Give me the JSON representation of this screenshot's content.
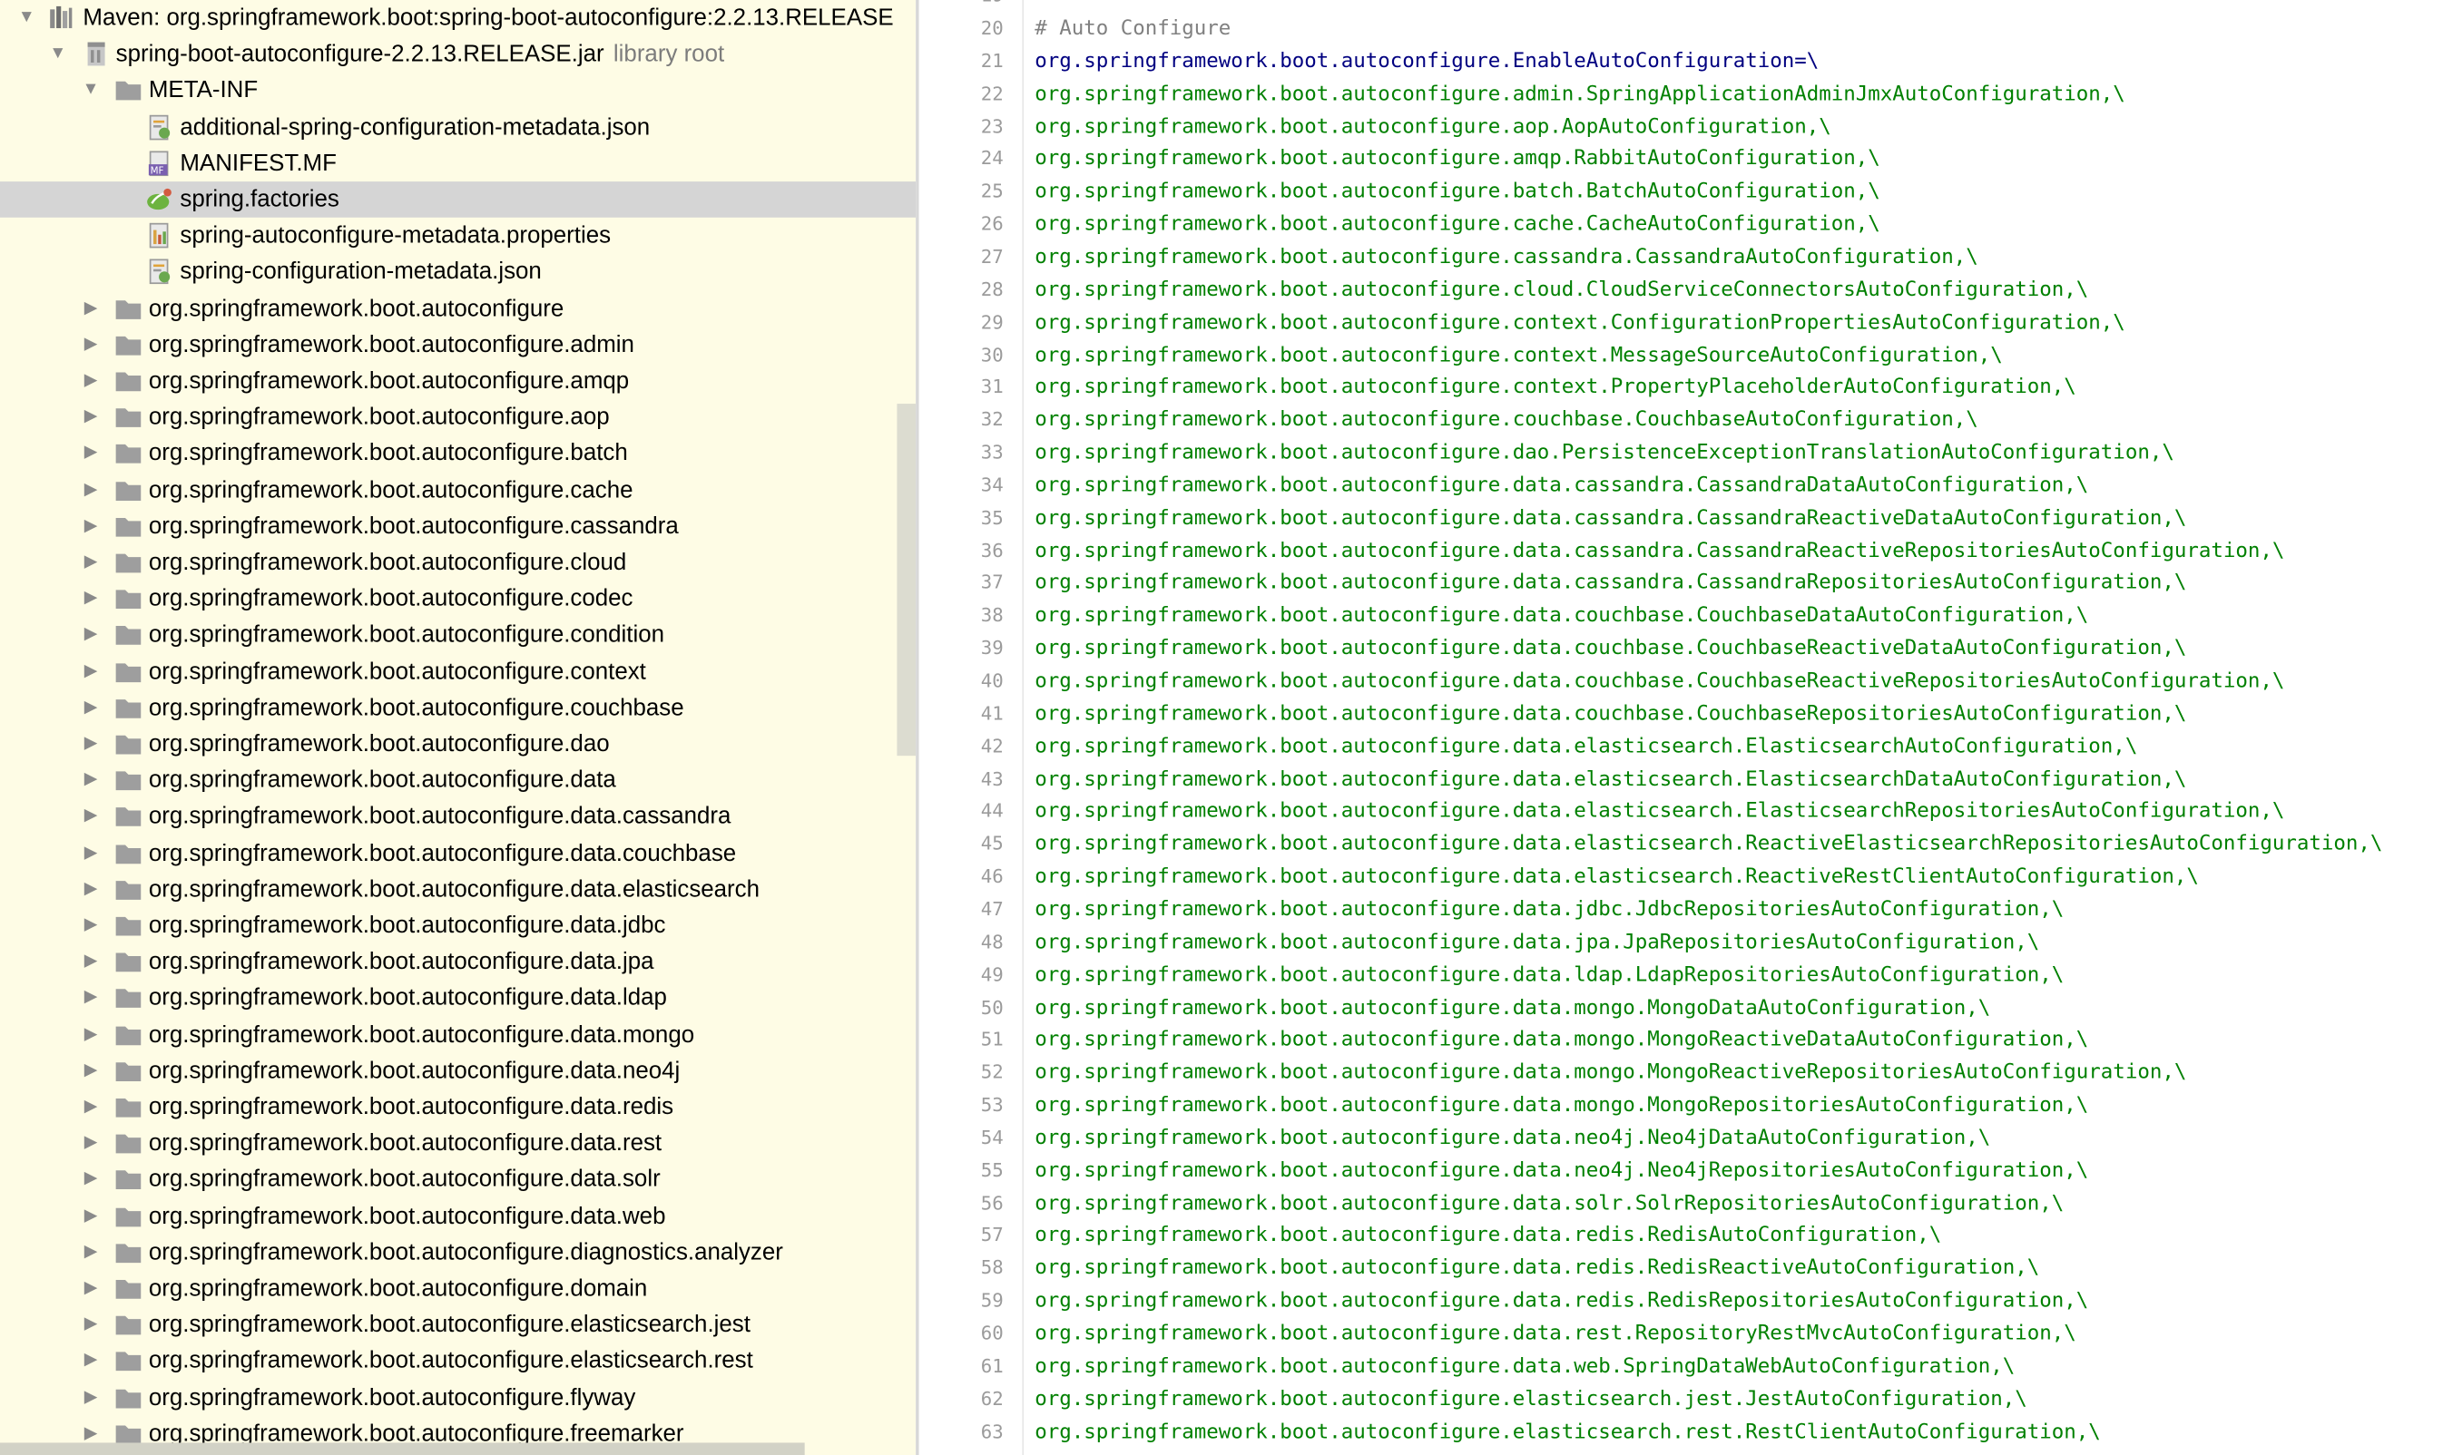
{
  "colors": {
    "tree_background": "#fefce5",
    "selected_row": "#d5d5d5",
    "property_key": "#000080",
    "property_value": "#008000",
    "comment": "#808080",
    "line_number": "#9b9b9b"
  },
  "tree": [
    {
      "label": "Maven: org.springframework.boot:spring-boot-autoconfigure:2.2.13.RELEASE",
      "icon": "library-icon",
      "state": "expanded"
    },
    {
      "label": "spring-boot-autoconfigure-2.2.13.RELEASE.jar",
      "sub": "library root",
      "icon": "jar-icon",
      "state": "expanded"
    },
    {
      "label": "META-INF",
      "icon": "folder-icon",
      "state": "expanded"
    },
    {
      "label": "additional-spring-configuration-metadata.json",
      "icon": "json-file-icon"
    },
    {
      "label": "MANIFEST.MF",
      "icon": "manifest-file-icon"
    },
    {
      "label": "spring.factories",
      "icon": "spring-factories-icon",
      "selected": true
    },
    {
      "label": "spring-autoconfigure-metadata.properties",
      "icon": "properties-file-icon"
    },
    {
      "label": "spring-configuration-metadata.json",
      "icon": "json-file-icon"
    },
    {
      "label": "org.springframework.boot.autoconfigure",
      "icon": "package-icon",
      "state": "collapsed"
    },
    {
      "label": "org.springframework.boot.autoconfigure.admin",
      "icon": "package-icon",
      "state": "collapsed"
    },
    {
      "label": "org.springframework.boot.autoconfigure.amqp",
      "icon": "package-icon",
      "state": "collapsed"
    },
    {
      "label": "org.springframework.boot.autoconfigure.aop",
      "icon": "package-icon",
      "state": "collapsed"
    },
    {
      "label": "org.springframework.boot.autoconfigure.batch",
      "icon": "package-icon",
      "state": "collapsed"
    },
    {
      "label": "org.springframework.boot.autoconfigure.cache",
      "icon": "package-icon",
      "state": "collapsed"
    },
    {
      "label": "org.springframework.boot.autoconfigure.cassandra",
      "icon": "package-icon",
      "state": "collapsed"
    },
    {
      "label": "org.springframework.boot.autoconfigure.cloud",
      "icon": "package-icon",
      "state": "collapsed"
    },
    {
      "label": "org.springframework.boot.autoconfigure.codec",
      "icon": "package-icon",
      "state": "collapsed"
    },
    {
      "label": "org.springframework.boot.autoconfigure.condition",
      "icon": "package-icon",
      "state": "collapsed"
    },
    {
      "label": "org.springframework.boot.autoconfigure.context",
      "icon": "package-icon",
      "state": "collapsed"
    },
    {
      "label": "org.springframework.boot.autoconfigure.couchbase",
      "icon": "package-icon",
      "state": "collapsed"
    },
    {
      "label": "org.springframework.boot.autoconfigure.dao",
      "icon": "package-icon",
      "state": "collapsed"
    },
    {
      "label": "org.springframework.boot.autoconfigure.data",
      "icon": "package-icon",
      "state": "collapsed"
    },
    {
      "label": "org.springframework.boot.autoconfigure.data.cassandra",
      "icon": "package-icon",
      "state": "collapsed"
    },
    {
      "label": "org.springframework.boot.autoconfigure.data.couchbase",
      "icon": "package-icon",
      "state": "collapsed"
    },
    {
      "label": "org.springframework.boot.autoconfigure.data.elasticsearch",
      "icon": "package-icon",
      "state": "collapsed"
    },
    {
      "label": "org.springframework.boot.autoconfigure.data.jdbc",
      "icon": "package-icon",
      "state": "collapsed"
    },
    {
      "label": "org.springframework.boot.autoconfigure.data.jpa",
      "icon": "package-icon",
      "state": "collapsed"
    },
    {
      "label": "org.springframework.boot.autoconfigure.data.ldap",
      "icon": "package-icon",
      "state": "collapsed"
    },
    {
      "label": "org.springframework.boot.autoconfigure.data.mongo",
      "icon": "package-icon",
      "state": "collapsed"
    },
    {
      "label": "org.springframework.boot.autoconfigure.data.neo4j",
      "icon": "package-icon",
      "state": "collapsed"
    },
    {
      "label": "org.springframework.boot.autoconfigure.data.redis",
      "icon": "package-icon",
      "state": "collapsed"
    },
    {
      "label": "org.springframework.boot.autoconfigure.data.rest",
      "icon": "package-icon",
      "state": "collapsed"
    },
    {
      "label": "org.springframework.boot.autoconfigure.data.solr",
      "icon": "package-icon",
      "state": "collapsed"
    },
    {
      "label": "org.springframework.boot.autoconfigure.data.web",
      "icon": "package-icon",
      "state": "collapsed"
    },
    {
      "label": "org.springframework.boot.autoconfigure.diagnostics.analyzer",
      "icon": "package-icon",
      "state": "collapsed"
    },
    {
      "label": "org.springframework.boot.autoconfigure.domain",
      "icon": "package-icon",
      "state": "collapsed"
    },
    {
      "label": "org.springframework.boot.autoconfigure.elasticsearch.jest",
      "icon": "package-icon",
      "state": "collapsed"
    },
    {
      "label": "org.springframework.boot.autoconfigure.elasticsearch.rest",
      "icon": "package-icon",
      "state": "collapsed"
    },
    {
      "label": "org.springframework.boot.autoconfigure.flyway",
      "icon": "package-icon",
      "state": "collapsed"
    },
    {
      "label": "org.springframework.boot.autoconfigure.freemarker",
      "icon": "package-icon",
      "state": "collapsed"
    }
  ],
  "editor": {
    "first_visible_line_number": "19",
    "lines": [
      {
        "n": "20",
        "kind": "comment",
        "text": "# Auto Configure"
      },
      {
        "n": "21",
        "kind": "key",
        "text": "org.springframework.boot.autoconfigure.EnableAutoConfiguration=\\"
      },
      {
        "n": "22",
        "kind": "value",
        "text": "org.springframework.boot.autoconfigure.admin.SpringApplicationAdminJmxAutoConfiguration,\\"
      },
      {
        "n": "23",
        "kind": "value",
        "text": "org.springframework.boot.autoconfigure.aop.AopAutoConfiguration,\\"
      },
      {
        "n": "24",
        "kind": "value",
        "text": "org.springframework.boot.autoconfigure.amqp.RabbitAutoConfiguration,\\"
      },
      {
        "n": "25",
        "kind": "value",
        "text": "org.springframework.boot.autoconfigure.batch.BatchAutoConfiguration,\\"
      },
      {
        "n": "26",
        "kind": "value",
        "text": "org.springframework.boot.autoconfigure.cache.CacheAutoConfiguration,\\"
      },
      {
        "n": "27",
        "kind": "value",
        "text": "org.springframework.boot.autoconfigure.cassandra.CassandraAutoConfiguration,\\"
      },
      {
        "n": "28",
        "kind": "value",
        "text": "org.springframework.boot.autoconfigure.cloud.CloudServiceConnectorsAutoConfiguration,\\"
      },
      {
        "n": "29",
        "kind": "value",
        "text": "org.springframework.boot.autoconfigure.context.ConfigurationPropertiesAutoConfiguration,\\"
      },
      {
        "n": "30",
        "kind": "value",
        "text": "org.springframework.boot.autoconfigure.context.MessageSourceAutoConfiguration,\\"
      },
      {
        "n": "31",
        "kind": "value",
        "text": "org.springframework.boot.autoconfigure.context.PropertyPlaceholderAutoConfiguration,\\"
      },
      {
        "n": "32",
        "kind": "value",
        "text": "org.springframework.boot.autoconfigure.couchbase.CouchbaseAutoConfiguration,\\"
      },
      {
        "n": "33",
        "kind": "value",
        "text": "org.springframework.boot.autoconfigure.dao.PersistenceExceptionTranslationAutoConfiguration,\\"
      },
      {
        "n": "34",
        "kind": "value",
        "text": "org.springframework.boot.autoconfigure.data.cassandra.CassandraDataAutoConfiguration,\\"
      },
      {
        "n": "35",
        "kind": "value",
        "text": "org.springframework.boot.autoconfigure.data.cassandra.CassandraReactiveDataAutoConfiguration,\\"
      },
      {
        "n": "36",
        "kind": "value",
        "text": "org.springframework.boot.autoconfigure.data.cassandra.CassandraReactiveRepositoriesAutoConfiguration,\\"
      },
      {
        "n": "37",
        "kind": "value",
        "text": "org.springframework.boot.autoconfigure.data.cassandra.CassandraRepositoriesAutoConfiguration,\\"
      },
      {
        "n": "38",
        "kind": "value",
        "text": "org.springframework.boot.autoconfigure.data.couchbase.CouchbaseDataAutoConfiguration,\\"
      },
      {
        "n": "39",
        "kind": "value",
        "text": "org.springframework.boot.autoconfigure.data.couchbase.CouchbaseReactiveDataAutoConfiguration,\\"
      },
      {
        "n": "40",
        "kind": "value",
        "text": "org.springframework.boot.autoconfigure.data.couchbase.CouchbaseReactiveRepositoriesAutoConfiguration,\\"
      },
      {
        "n": "41",
        "kind": "value",
        "text": "org.springframework.boot.autoconfigure.data.couchbase.CouchbaseRepositoriesAutoConfiguration,\\"
      },
      {
        "n": "42",
        "kind": "value",
        "text": "org.springframework.boot.autoconfigure.data.elasticsearch.ElasticsearchAutoConfiguration,\\"
      },
      {
        "n": "43",
        "kind": "value",
        "text": "org.springframework.boot.autoconfigure.data.elasticsearch.ElasticsearchDataAutoConfiguration,\\"
      },
      {
        "n": "44",
        "kind": "value",
        "text": "org.springframework.boot.autoconfigure.data.elasticsearch.ElasticsearchRepositoriesAutoConfiguration,\\"
      },
      {
        "n": "45",
        "kind": "value",
        "text": "org.springframework.boot.autoconfigure.data.elasticsearch.ReactiveElasticsearchRepositoriesAutoConfiguration,\\"
      },
      {
        "n": "46",
        "kind": "value",
        "text": "org.springframework.boot.autoconfigure.data.elasticsearch.ReactiveRestClientAutoConfiguration,\\"
      },
      {
        "n": "47",
        "kind": "value",
        "text": "org.springframework.boot.autoconfigure.data.jdbc.JdbcRepositoriesAutoConfiguration,\\"
      },
      {
        "n": "48",
        "kind": "value",
        "text": "org.springframework.boot.autoconfigure.data.jpa.JpaRepositoriesAutoConfiguration,\\"
      },
      {
        "n": "49",
        "kind": "value",
        "text": "org.springframework.boot.autoconfigure.data.ldap.LdapRepositoriesAutoConfiguration,\\"
      },
      {
        "n": "50",
        "kind": "value",
        "text": "org.springframework.boot.autoconfigure.data.mongo.MongoDataAutoConfiguration,\\"
      },
      {
        "n": "51",
        "kind": "value",
        "text": "org.springframework.boot.autoconfigure.data.mongo.MongoReactiveDataAutoConfiguration,\\"
      },
      {
        "n": "52",
        "kind": "value",
        "text": "org.springframework.boot.autoconfigure.data.mongo.MongoReactiveRepositoriesAutoConfiguration,\\"
      },
      {
        "n": "53",
        "kind": "value",
        "text": "org.springframework.boot.autoconfigure.data.mongo.MongoRepositoriesAutoConfiguration,\\"
      },
      {
        "n": "54",
        "kind": "value",
        "text": "org.springframework.boot.autoconfigure.data.neo4j.Neo4jDataAutoConfiguration,\\"
      },
      {
        "n": "55",
        "kind": "value",
        "text": "org.springframework.boot.autoconfigure.data.neo4j.Neo4jRepositoriesAutoConfiguration,\\"
      },
      {
        "n": "56",
        "kind": "value",
        "text": "org.springframework.boot.autoconfigure.data.solr.SolrRepositoriesAutoConfiguration,\\"
      },
      {
        "n": "57",
        "kind": "value",
        "text": "org.springframework.boot.autoconfigure.data.redis.RedisAutoConfiguration,\\"
      },
      {
        "n": "58",
        "kind": "value",
        "text": "org.springframework.boot.autoconfigure.data.redis.RedisReactiveAutoConfiguration,\\"
      },
      {
        "n": "59",
        "kind": "value",
        "text": "org.springframework.boot.autoconfigure.data.redis.RedisRepositoriesAutoConfiguration,\\"
      },
      {
        "n": "60",
        "kind": "value",
        "text": "org.springframework.boot.autoconfigure.data.rest.RepositoryRestMvcAutoConfiguration,\\"
      },
      {
        "n": "61",
        "kind": "value",
        "text": "org.springframework.boot.autoconfigure.data.web.SpringDataWebAutoConfiguration,\\"
      },
      {
        "n": "62",
        "kind": "value",
        "text": "org.springframework.boot.autoconfigure.elasticsearch.jest.JestAutoConfiguration,\\"
      },
      {
        "n": "63",
        "kind": "value",
        "text": "org.springframework.boot.autoconfigure.elasticsearch.rest.RestClientAutoConfiguration,\\"
      }
    ]
  }
}
